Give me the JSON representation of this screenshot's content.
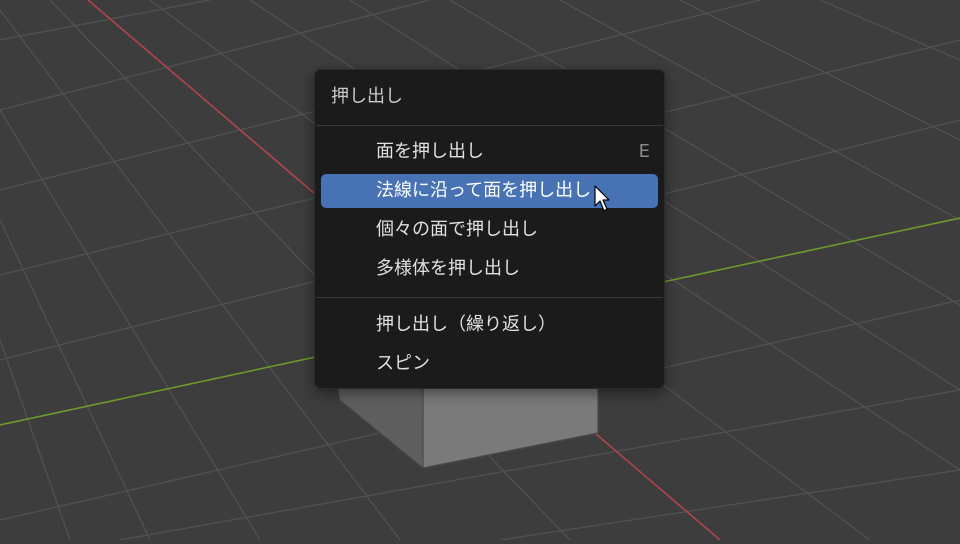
{
  "viewport": {
    "background": "#3d3d3d",
    "grid_color": "#505050",
    "x_axis_color": "#b2434f",
    "y_axis_color": "#6d9a2c"
  },
  "menu": {
    "title": "押し出し",
    "items": [
      {
        "label": "面を押し出し",
        "shortcut": "E",
        "highlighted": false
      },
      {
        "label": "法線に沿って面を押し出し",
        "shortcut": "",
        "highlighted": true
      },
      {
        "label": "個々の面で押し出し",
        "shortcut": "",
        "highlighted": false
      },
      {
        "label": "多様体を押し出し",
        "shortcut": "",
        "highlighted": false
      },
      {
        "label": "押し出し（繰り返し）",
        "shortcut": "",
        "highlighted": false
      },
      {
        "label": "スピン",
        "shortcut": "",
        "highlighted": false
      }
    ],
    "highlight_color": "#4772b3"
  },
  "cursor": {
    "icon": "mouse-pointer-icon"
  }
}
